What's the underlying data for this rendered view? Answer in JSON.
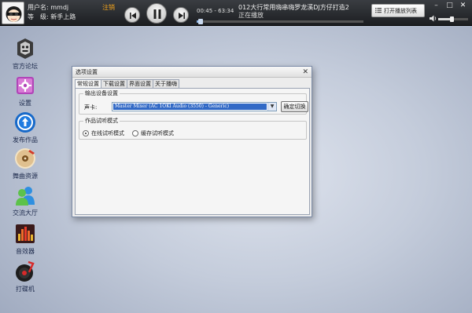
{
  "user": {
    "name_line": "用户名: mmdj",
    "level_line": "等　级: 新手上路",
    "logout": "注销"
  },
  "player": {
    "time": "00:45 - 63:34",
    "song": "012大行常用嗨串嗨罗龙溪DJ方仔打造2",
    "status": "正在播放",
    "progress": 0.012,
    "volume": 0.45,
    "playlist_button": "打开播放列表"
  },
  "sidebar": {
    "items": [
      {
        "label": "官方论坛",
        "icon": "forum-robot-icon"
      },
      {
        "label": "设置",
        "icon": "settings-icon"
      },
      {
        "label": "发布作品",
        "icon": "publish-icon"
      },
      {
        "label": "舞曲资源",
        "icon": "music-disc-icon"
      },
      {
        "label": "交流大厅",
        "icon": "chat-hall-icon"
      },
      {
        "label": "音效器",
        "icon": "equalizer-icon"
      },
      {
        "label": "打碟机",
        "icon": "turntable-icon"
      }
    ]
  },
  "dialog": {
    "title": "选项设置",
    "tabs": [
      "常规设置",
      "下载设置",
      "界面设置",
      "关于播嗨"
    ],
    "active_tab": 0,
    "output_group": {
      "legend": "输出设备设置",
      "sound_card_label": "声卡:",
      "sound_card_value": "Master Mixer (AC 1OKl Audio (3550) - Generic)",
      "confirm_button": "确定切换"
    },
    "mode_group": {
      "legend": "作品试听模式",
      "options": [
        "在线试听模式",
        "缓存试听模式"
      ],
      "selected": 0
    }
  },
  "colors": {
    "accent": "#3169c6",
    "logout": "#f4a51c",
    "topbar": "#2a2c30"
  }
}
